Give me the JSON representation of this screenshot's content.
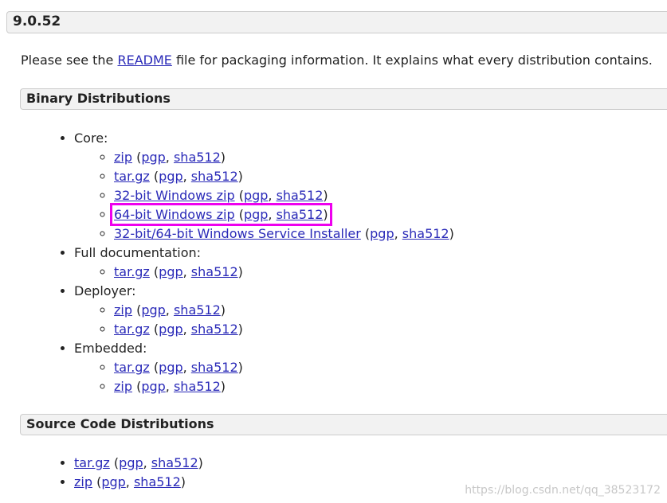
{
  "version": "9.0.52",
  "intro": {
    "before": "Please see the ",
    "link": "README",
    "after": " file for packaging information. It explains what every distribution contains."
  },
  "binary": {
    "title": "Binary Distributions",
    "groups": [
      {
        "label": "Core:",
        "items": [
          {
            "main": "zip",
            "sig1": "pgp",
            "sig2": "sha512"
          },
          {
            "main": "tar.gz",
            "sig1": "pgp",
            "sig2": "sha512"
          },
          {
            "main": "32-bit Windows zip",
            "sig1": "pgp",
            "sig2": "sha512"
          },
          {
            "main": "64-bit Windows zip",
            "sig1": "pgp",
            "sig2": "sha512"
          },
          {
            "main": "32-bit/64-bit Windows Service Installer",
            "sig1": "pgp",
            "sig2": "sha512"
          }
        ]
      },
      {
        "label": "Full documentation:",
        "items": [
          {
            "main": "tar.gz",
            "sig1": "pgp",
            "sig2": "sha512"
          }
        ]
      },
      {
        "label": "Deployer:",
        "items": [
          {
            "main": "zip",
            "sig1": "pgp",
            "sig2": "sha512"
          },
          {
            "main": "tar.gz",
            "sig1": "pgp",
            "sig2": "sha512"
          }
        ]
      },
      {
        "label": "Embedded:",
        "items": [
          {
            "main": "tar.gz",
            "sig1": "pgp",
            "sig2": "sha512"
          },
          {
            "main": "zip",
            "sig1": "pgp",
            "sig2": "sha512"
          }
        ]
      }
    ]
  },
  "source": {
    "title": "Source Code Distributions",
    "items": [
      {
        "main": "tar.gz",
        "sig1": "pgp",
        "sig2": "sha512"
      },
      {
        "main": "zip",
        "sig1": "pgp",
        "sig2": "sha512"
      }
    ]
  },
  "watermark": "https://blog.csdn.net/qq_38523172",
  "colors": {
    "link": "#2a2ab8",
    "highlight": "#ee00ee",
    "header_bg": "#f2f2f2"
  }
}
